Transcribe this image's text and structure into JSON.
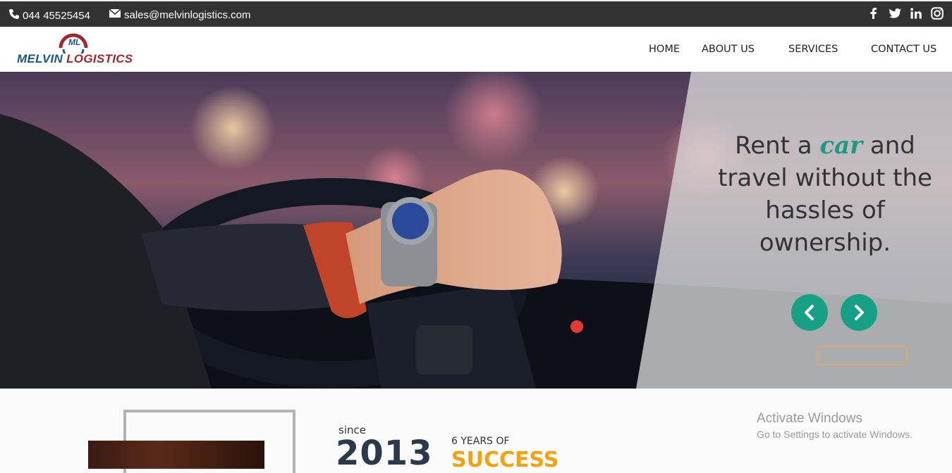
{
  "topbar": {
    "phone": "044 45525454",
    "email": "sales@melvinlogistics.com",
    "social": [
      "f",
      "t",
      "in",
      "ig"
    ]
  },
  "logo": {
    "word1": "MELVIN",
    "word2": "LOGISTICS",
    "mark": "ML"
  },
  "nav": {
    "home": "HOME",
    "about": "ABOUT US",
    "services": "SERVICES",
    "contact": "CONTACT US"
  },
  "hero": {
    "line1_pre": "Rent a ",
    "line1_em": "car",
    "line1_post": " and",
    "line2": "travel without the hassles of ownership."
  },
  "stats": {
    "since": "since",
    "year": "2013",
    "years_of": "6 YEARS OF",
    "success": "SUCCESS"
  },
  "watermark": {
    "title": "Activate Windows",
    "subtitle": "Go to Settings to activate Windows."
  },
  "colors": {
    "accent": "#16a085",
    "topbar": "#323232",
    "success": "#f2a30f"
  }
}
